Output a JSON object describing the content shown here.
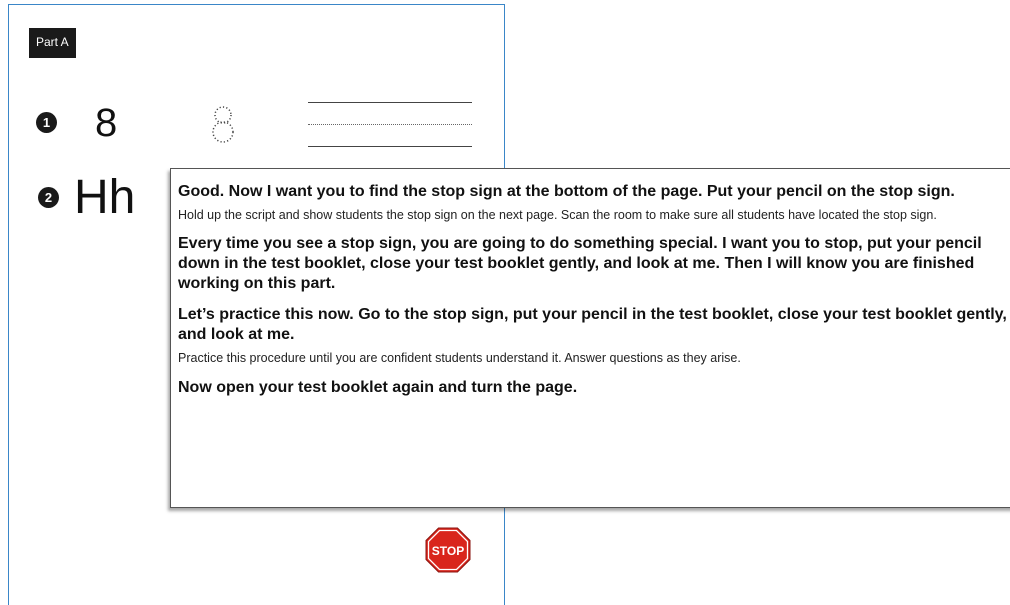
{
  "booklet": {
    "part_label": "Part A",
    "items": [
      {
        "number": "1",
        "glyph": "8",
        "traced_glyph": "8"
      },
      {
        "number": "2",
        "glyph": "Hh"
      }
    ],
    "stop_sign_text": "STOP"
  },
  "script": {
    "paragraphs": [
      "Good. Now I want you to find the stop sign at the bottom of the page. Put your pencil on the stop sign.",
      "Hold up the script and show students the stop sign on the next page. Scan the room to make sure all students have located the stop sign.",
      "Every time you see a stop sign, you are going to do something special. I want you to stop, put your pencil down in the test booklet, close your test booklet gently, and look at me. Then I will know you are finished working on this part.",
      "Let’s practice this now. Go to the stop sign, put your pencil in the test booklet, close your test booklet gently, and look at me.",
      "Practice this procedure until you are confident students understand it. Answer questions as they arise.",
      "Now open your test booklet again and turn the page."
    ]
  },
  "colors": {
    "page_border": "#3a86c8",
    "stop_red": "#d9251c",
    "label_bg": "#1a1a1a"
  }
}
